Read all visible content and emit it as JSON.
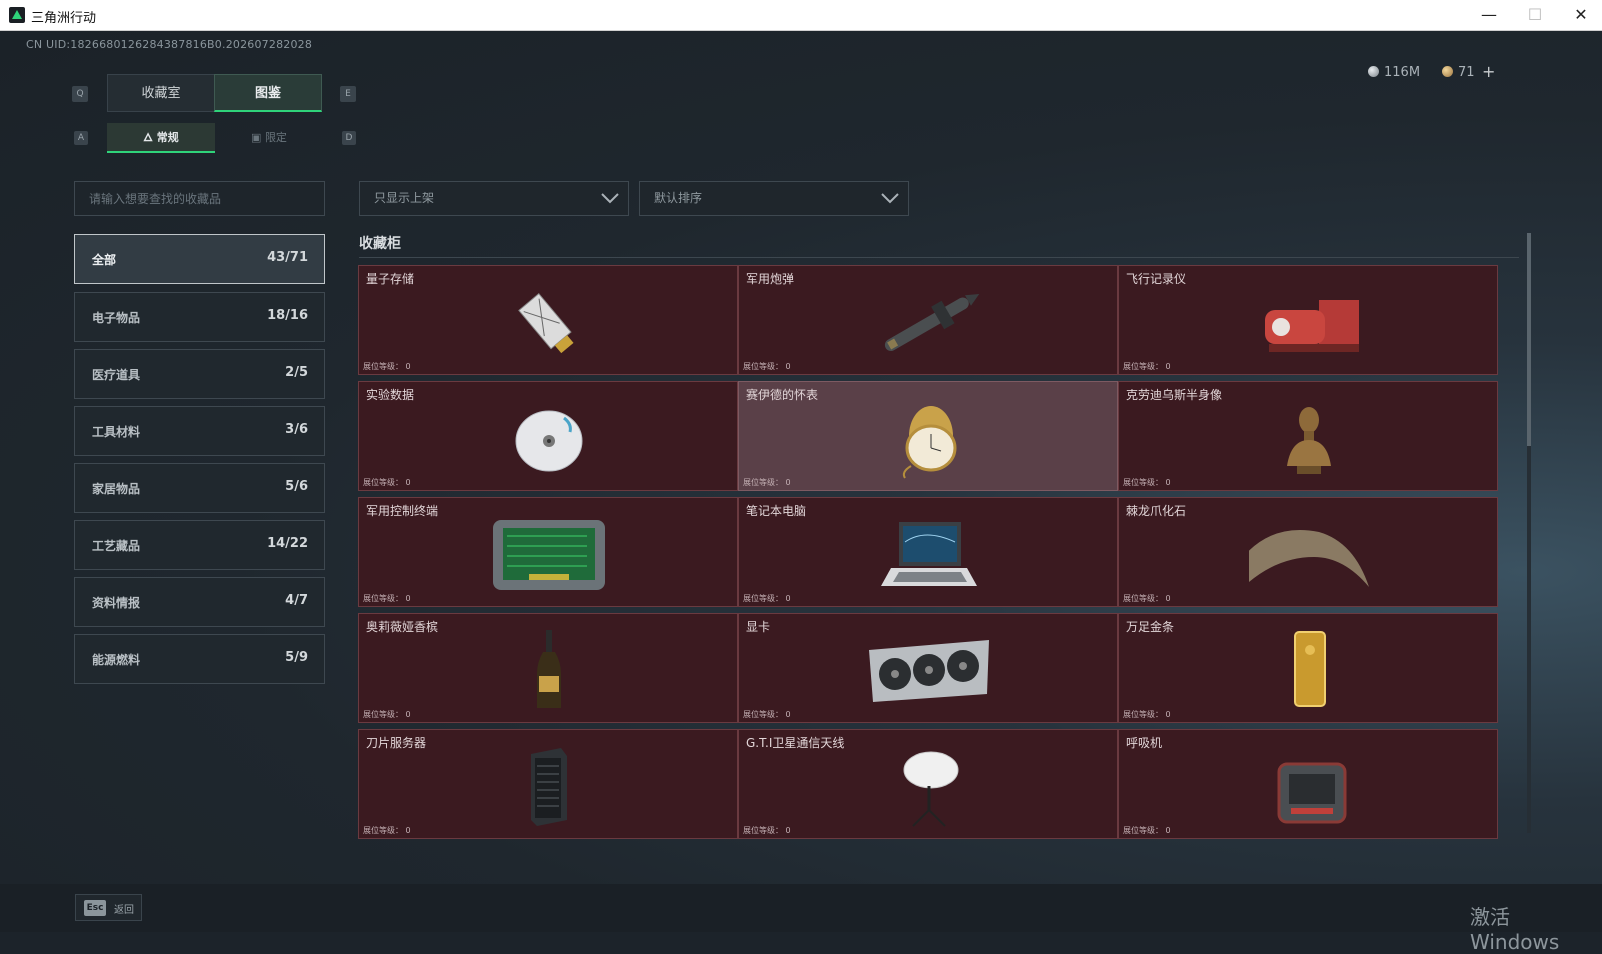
{
  "window": {
    "title": "三角洲行动"
  },
  "header": {
    "uid": "CN UID:1826680126284387816B0.202607282028",
    "silver": "116M",
    "gold": "71",
    "plus": "+"
  },
  "tabs": {
    "main": [
      {
        "label": "收藏室"
      },
      {
        "label": "图鉴"
      }
    ],
    "sub": [
      {
        "label": "常规"
      },
      {
        "label": "限定"
      }
    ],
    "keys": {
      "q": "Q",
      "e": "E",
      "a": "A",
      "d": "D"
    }
  },
  "search": {
    "placeholder": "请输入想要查找的收藏品"
  },
  "filters": {
    "show": "只显示上架",
    "sort": "默认排序"
  },
  "categories": [
    {
      "name": "全部",
      "count": "43/71"
    },
    {
      "name": "电子物品",
      "count": "18/16"
    },
    {
      "name": "医疗道具",
      "count": "2/5"
    },
    {
      "name": "工具材料",
      "count": "3/6"
    },
    {
      "name": "家居物品",
      "count": "5/6"
    },
    {
      "name": "工艺藏品",
      "count": "14/22"
    },
    {
      "name": "资料情报",
      "count": "4/7"
    },
    {
      "name": "能源燃料",
      "count": "5/9"
    }
  ],
  "section": {
    "title": "收藏柜"
  },
  "level_label": "展位等级： 0",
  "items": [
    {
      "name": "量子存储",
      "icon": "usb-drive-icon"
    },
    {
      "name": "军用炮弹",
      "icon": "missile-icon"
    },
    {
      "name": "飞行记录仪",
      "icon": "flight-recorder-icon"
    },
    {
      "name": "实验数据",
      "icon": "disc-icon"
    },
    {
      "name": "赛伊德的怀表",
      "icon": "pocket-watch-icon"
    },
    {
      "name": "克劳迪乌斯半身像",
      "icon": "bust-icon"
    },
    {
      "name": "军用控制终端",
      "icon": "control-terminal-icon"
    },
    {
      "name": "笔记本电脑",
      "icon": "laptop-icon"
    },
    {
      "name": "棘龙爪化石",
      "icon": "claw-fossil-icon"
    },
    {
      "name": "奥莉薇娅香槟",
      "icon": "champagne-icon"
    },
    {
      "name": "显卡",
      "icon": "graphics-card-icon"
    },
    {
      "name": "万足金条",
      "icon": "gold-bar-icon"
    },
    {
      "name": "刀片服务器",
      "icon": "server-icon"
    },
    {
      "name": "G.T.I卫星通信天线",
      "icon": "satellite-dish-icon"
    },
    {
      "name": "呼吸机",
      "icon": "ventilator-icon"
    }
  ],
  "bottom": {
    "esc_key": "Esc",
    "back_label": "返回"
  },
  "watermark": "激活 Windows",
  "colors": {
    "accent": "#2fd37a",
    "card": "#3b1a20",
    "card_highlight": "#5a4048"
  }
}
